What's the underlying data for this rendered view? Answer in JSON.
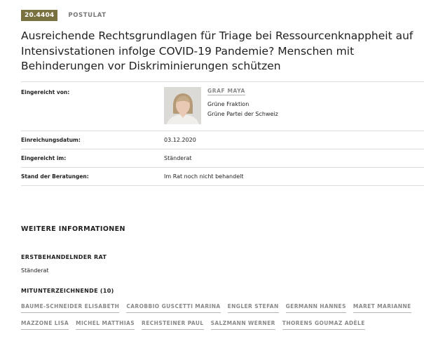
{
  "header": {
    "business_number": "20.4404",
    "business_type": "POSTULAT"
  },
  "title": "Ausreichende Rechtsgrundlagen für Triage bei Ressourcenknappheit auf Intensivstationen infolge COVID-19 Pandemie? Menschen mit Behinderungen vor Diskriminierungen schützen",
  "details": {
    "submitted_by_label": "Eingereicht von:",
    "author_name": "GRAF MAYA",
    "author_group": "Grüne Fraktion",
    "author_party": "Grüne Partei der Schweiz",
    "submission_date_label": "Einreichungsdatum:",
    "submission_date": "03.12.2020",
    "submitted_in_label": "Eingereicht im:",
    "submitted_in": "Ständerat",
    "status_label": "Stand der Beratungen:",
    "status": "Im Rat noch nicht behandelt"
  },
  "more_info": {
    "title": "WEITERE INFORMATIONEN",
    "first_council_label": "ERSTBEHANDELNDER RAT",
    "first_council": "Ständerat",
    "cosigners_label": "MITUNTERZEICHNENDE (10)",
    "cosigners": [
      "BAUME-SCHNEIDER ELISABETH",
      "CAROBBIO GUSCETTI MARINA",
      "ENGLER STEFAN",
      "GERMANN HANNES",
      "MARET MARIANNE",
      "MAZZONE LISA",
      "MICHEL MATTHIAS",
      "RECHSTEINER PAUL",
      "SALZMANN WERNER",
      "THORENS GOUMAZ ADÈLE"
    ]
  },
  "colors": {
    "badge": "#7a7140",
    "link": "#8a8a8a",
    "divider": "#dcdcdc"
  }
}
